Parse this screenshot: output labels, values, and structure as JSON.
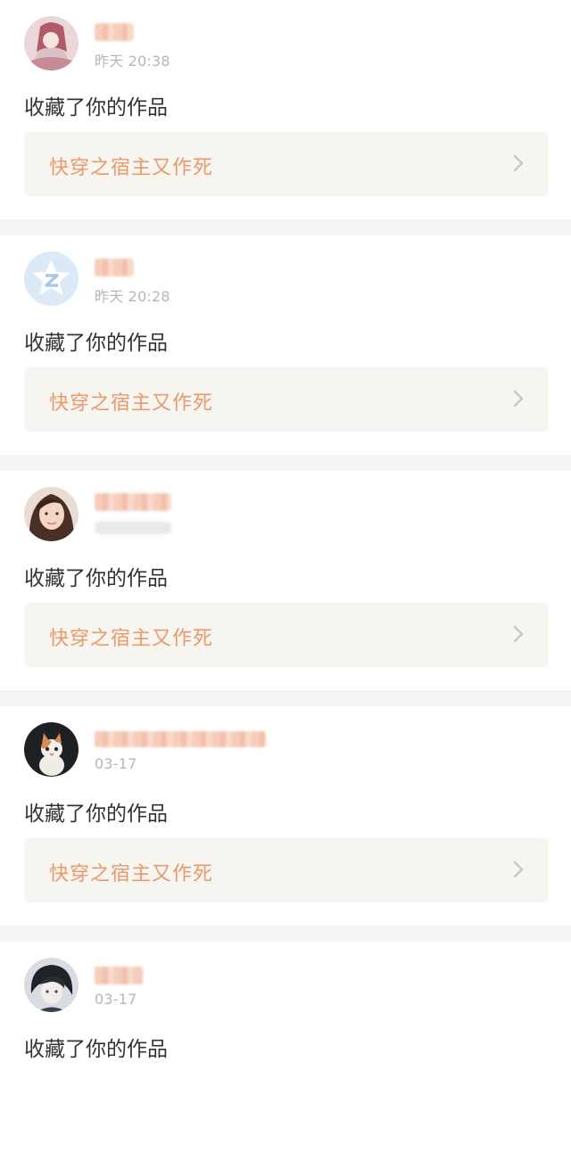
{
  "notifications": [
    {
      "time": "昨天 20:38",
      "action": "收藏了你的作品",
      "work_title": "快穿之宿主又作死",
      "avatar_icon": "avatar-anime-girl-icon"
    },
    {
      "time": "昨天 20:28",
      "action": "收藏了你的作品",
      "work_title": "快穿之宿主又作死",
      "avatar_icon": "avatar-default-star-icon"
    },
    {
      "time": "",
      "action": "收藏了你的作品",
      "work_title": "快穿之宿主又作死",
      "avatar_icon": "avatar-girl-photo-icon"
    },
    {
      "time": "03-17",
      "action": "收藏了你的作品",
      "work_title": "快穿之宿主又作死",
      "avatar_icon": "avatar-cat-icon"
    },
    {
      "time": "03-17",
      "action": "收藏了你的作品",
      "work_title": "",
      "avatar_icon": "avatar-anime-boy-icon"
    }
  ],
  "colors": {
    "accent": "#e89a6d",
    "card_bg": "#f6f5ef",
    "divider": "#f4f4f4",
    "meta_text": "#b6b6b6"
  }
}
